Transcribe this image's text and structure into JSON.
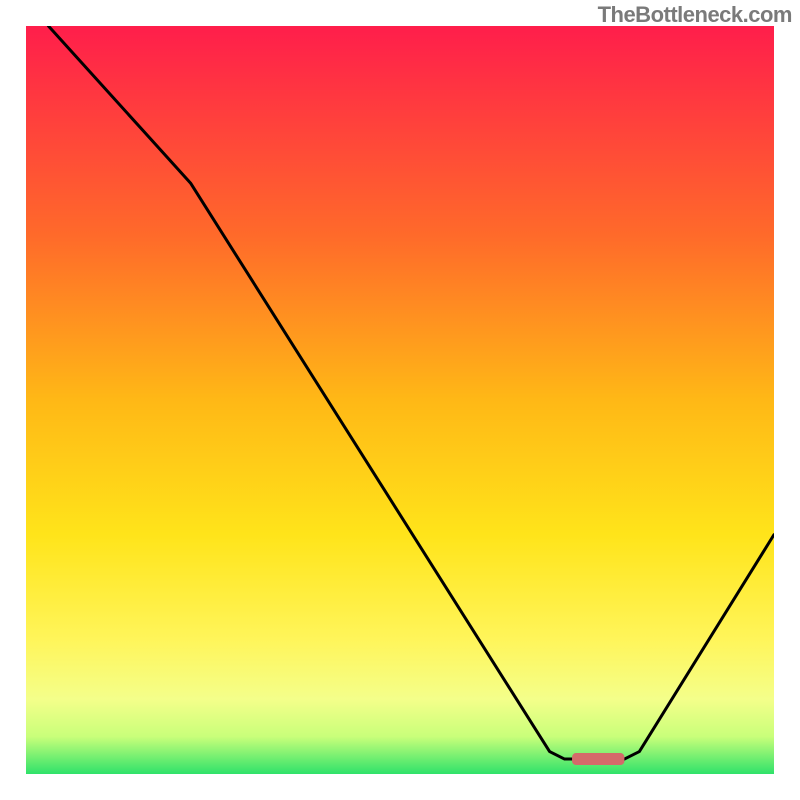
{
  "attribution": "TheBottleneck.com",
  "chart_data": {
    "type": "line",
    "title": "",
    "xlabel": "",
    "ylabel": "",
    "xlim": [
      0,
      100
    ],
    "ylim": [
      0,
      100
    ],
    "curve_points": [
      {
        "x": 3,
        "y": 100
      },
      {
        "x": 22,
        "y": 79
      },
      {
        "x": 70,
        "y": 3
      },
      {
        "x": 72,
        "y": 2
      },
      {
        "x": 80,
        "y": 2
      },
      {
        "x": 82,
        "y": 3
      },
      {
        "x": 100,
        "y": 32
      }
    ],
    "optimum_marker": {
      "x_start": 73,
      "x_end": 80,
      "y": 2
    },
    "gradient_stops": [
      {
        "offset": 0,
        "color": "#ff1e4b"
      },
      {
        "offset": 28,
        "color": "#ff6a2a"
      },
      {
        "offset": 50,
        "color": "#ffb816"
      },
      {
        "offset": 68,
        "color": "#ffe41a"
      },
      {
        "offset": 82,
        "color": "#fff55a"
      },
      {
        "offset": 90,
        "color": "#f4ff8a"
      },
      {
        "offset": 95,
        "color": "#c9ff7a"
      },
      {
        "offset": 100,
        "color": "#2fe26a"
      }
    ],
    "marker_color": "#d46a6a",
    "curve_color": "#000000",
    "frame_color": "#ffffff"
  }
}
